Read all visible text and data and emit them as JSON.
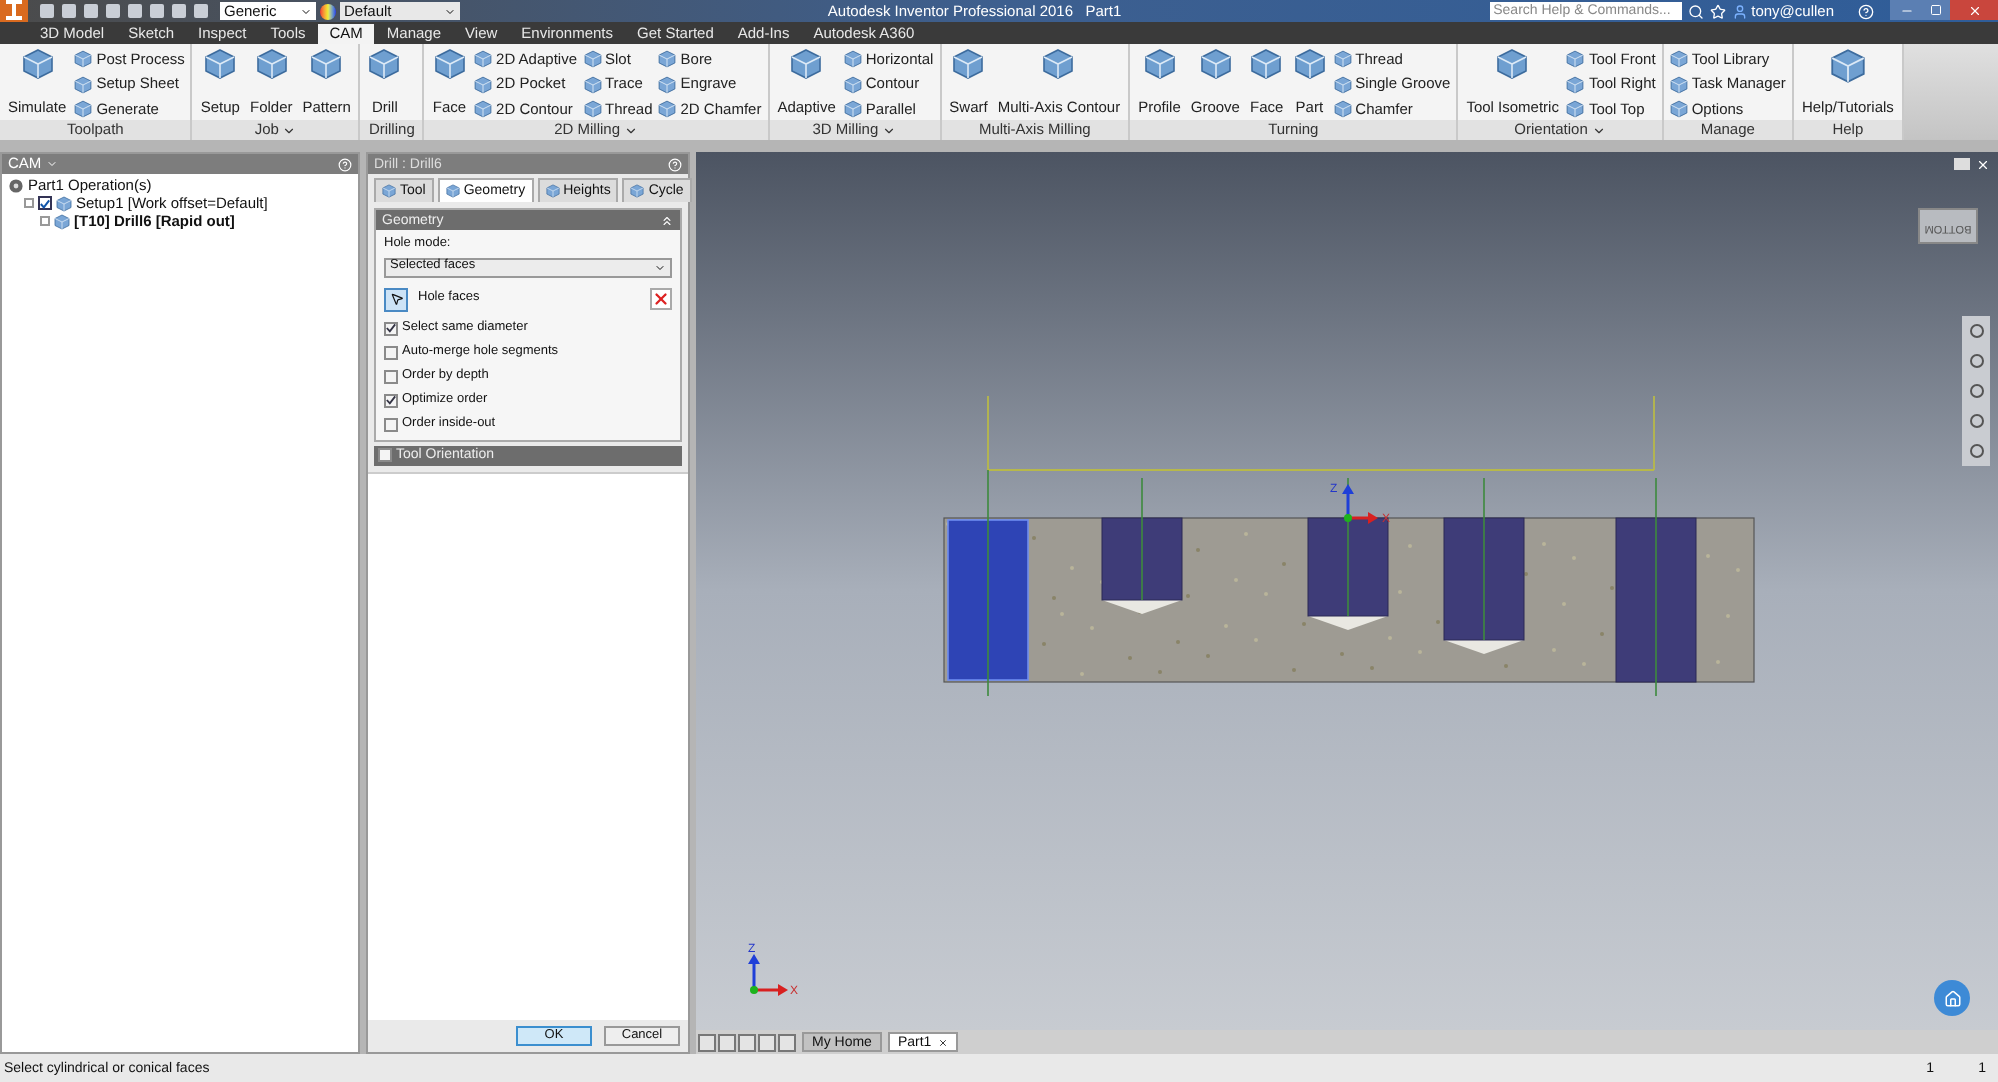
{
  "title_bar": {
    "workspace": "Generic",
    "appearance": "Default",
    "title": "Autodesk Inventor Professional 2016   Part1",
    "search": {
      "placeholder": "Search Help & Commands..."
    },
    "user": "tony@cullen"
  },
  "menu_tabs": [
    {
      "label": "3D Model",
      "selected": false
    },
    {
      "label": "Sketch",
      "selected": false
    },
    {
      "label": "Inspect",
      "selected": false
    },
    {
      "label": "Tools",
      "selected": false
    },
    {
      "label": "CAM",
      "selected": true
    },
    {
      "label": "Manage",
      "selected": false
    },
    {
      "label": "View",
      "selected": false
    },
    {
      "label": "Environments",
      "selected": false
    },
    {
      "label": "Get Started",
      "selected": false
    },
    {
      "label": "Add-Ins",
      "selected": false
    },
    {
      "label": "Autodesk A360",
      "selected": false
    }
  ],
  "ribbon": {
    "groups": [
      {
        "label": "Toolpath",
        "dropdown": false,
        "items": [
          {
            "label": "Simulate",
            "kind": "large"
          },
          {
            "label": "Post Process",
            "kind": "small"
          },
          {
            "label": "Setup Sheet",
            "kind": "small"
          },
          {
            "label": "Generate",
            "kind": "small"
          }
        ]
      },
      {
        "label": "Job",
        "dropdown": true,
        "items": [
          {
            "label": "Setup",
            "kind": "large"
          },
          {
            "label": "Folder",
            "kind": "large"
          },
          {
            "label": "Pattern",
            "kind": "large"
          }
        ]
      },
      {
        "label": "Drilling",
        "dropdown": false,
        "items": [
          {
            "label": "Drill",
            "kind": "large"
          }
        ]
      },
      {
        "label": "2D Milling",
        "dropdown": true,
        "items": [
          {
            "label": "Face",
            "kind": "large"
          },
          {
            "label": "2D Adaptive",
            "kind": "small"
          },
          {
            "label": "2D Pocket",
            "kind": "small"
          },
          {
            "label": "2D Contour",
            "kind": "small"
          },
          {
            "label": "Slot",
            "kind": "small"
          },
          {
            "label": "Trace",
            "kind": "small"
          },
          {
            "label": "Thread",
            "kind": "small"
          },
          {
            "label": "Bore",
            "kind": "small"
          },
          {
            "label": "Engrave",
            "kind": "small"
          },
          {
            "label": "2D Chamfer",
            "kind": "small"
          }
        ]
      },
      {
        "label": "3D Milling",
        "dropdown": true,
        "items": [
          {
            "label": "Adaptive",
            "kind": "large"
          },
          {
            "label": "Horizontal",
            "kind": "small"
          },
          {
            "label": "Contour",
            "kind": "small"
          },
          {
            "label": "Parallel",
            "kind": "small"
          }
        ]
      },
      {
        "label": "Multi-Axis Milling",
        "dropdown": false,
        "items": [
          {
            "label": "Swarf",
            "kind": "large"
          },
          {
            "label": "Multi-Axis Contour",
            "kind": "large"
          }
        ]
      },
      {
        "label": "Turning",
        "dropdown": false,
        "items": [
          {
            "label": "Profile",
            "kind": "large"
          },
          {
            "label": "Groove",
            "kind": "large"
          },
          {
            "label": "Face",
            "kind": "large"
          },
          {
            "label": "Part",
            "kind": "large"
          },
          {
            "label": "Thread",
            "kind": "small"
          },
          {
            "label": "Single Groove",
            "kind": "small"
          },
          {
            "label": "Chamfer",
            "kind": "small"
          }
        ]
      },
      {
        "label": "Orientation",
        "dropdown": true,
        "items": [
          {
            "label": "Tool Isometric",
            "kind": "large"
          },
          {
            "label": "Tool Front",
            "kind": "small"
          },
          {
            "label": "Tool Right",
            "kind": "small"
          },
          {
            "label": "Tool Top",
            "kind": "small"
          }
        ]
      },
      {
        "label": "Manage",
        "dropdown": false,
        "items": [
          {
            "label": "Tool Library",
            "kind": "small"
          },
          {
            "label": "Task Manager",
            "kind": "small"
          },
          {
            "label": "Options",
            "kind": "small"
          }
        ]
      },
      {
        "label": "Help",
        "dropdown": false,
        "items": [
          {
            "label": "Help/Tutorials",
            "kind": "large"
          }
        ]
      }
    ]
  },
  "browser": {
    "title": "CAM",
    "tree": [
      {
        "label": "Part1 Operation(s)",
        "kind": "root",
        "children": [
          {
            "label": "Setup1 [Work offset=Default]",
            "kind": "setup",
            "checked": true,
            "children": [
              {
                "label": "[T10] Drill6 [Rapid out]",
                "kind": "operation"
              }
            ]
          }
        ]
      }
    ]
  },
  "dialog": {
    "title": "Drill : Drill6",
    "tabs": [
      {
        "label": "Tool",
        "selected": false
      },
      {
        "label": "Geometry",
        "selected": true
      },
      {
        "label": "Heights",
        "selected": false
      },
      {
        "label": "Cycle",
        "selected": false
      }
    ],
    "geometry": {
      "title": "Geometry",
      "hole_mode_label": "Hole mode:",
      "hole_mode": "Selected faces",
      "selection_button": "Hole faces",
      "options": [
        {
          "label": "Select same diameter",
          "checked": true
        },
        {
          "label": "Auto-merge hole segments",
          "checked": false
        },
        {
          "label": "Order by depth",
          "checked": false
        },
        {
          "label": "Optimize order",
          "checked": true
        },
        {
          "label": "Order inside-out",
          "checked": false
        }
      ]
    },
    "tool_orientation": {
      "title": "Tool Orientation",
      "checked": false
    },
    "buttons": [
      "OK",
      "Cancel"
    ]
  },
  "viewport": {
    "viewcube_face": "BOTTOM",
    "model_triad": {
      "z": "Z",
      "x": "X"
    },
    "corner_triad": {
      "z": "Z",
      "x": "X"
    }
  },
  "document_tabs": [
    {
      "label": "My Home",
      "selected": false
    },
    {
      "label": "Part1",
      "selected": true
    }
  ],
  "status_bar": {
    "message": "Select cylindrical or conical faces",
    "counters": [
      "1",
      "1"
    ]
  }
}
